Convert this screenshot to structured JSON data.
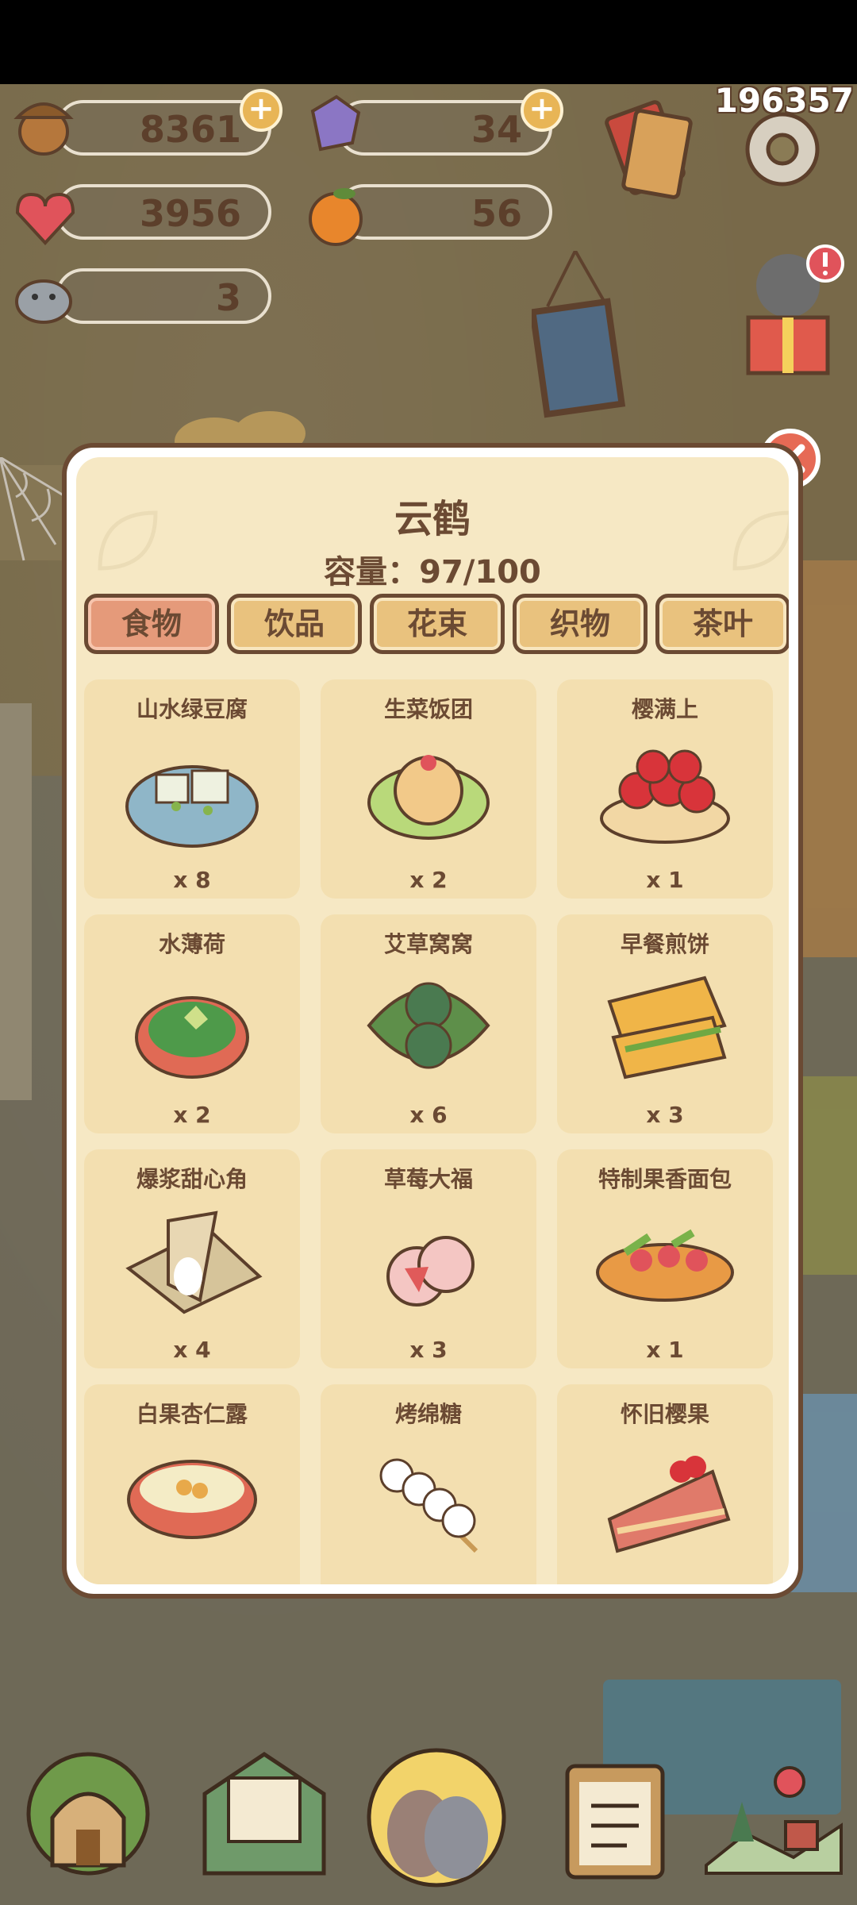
{
  "hud": {
    "score": "196357",
    "acorns": "8361",
    "gems": "34",
    "hearts": "3956",
    "oranges": "56",
    "bird_count": "3"
  },
  "panel": {
    "title": "云鹤",
    "capacity": "容量：97/100",
    "tabs": [
      "食物",
      "饮品",
      "花束",
      "织物",
      "茶叶"
    ],
    "active_tab": "食物",
    "items": [
      {
        "name": "山水绿豆腐",
        "count": "x 8"
      },
      {
        "name": "生菜饭团",
        "count": "x 2"
      },
      {
        "name": "樱满上",
        "count": "x 1"
      },
      {
        "name": "水薄荷",
        "count": "x 2"
      },
      {
        "name": "艾草窝窝",
        "count": "x 6"
      },
      {
        "name": "早餐煎饼",
        "count": "x 3"
      },
      {
        "name": "爆浆甜心角",
        "count": "x 4"
      },
      {
        "name": "草莓大福",
        "count": "x 3"
      },
      {
        "name": "特制果香面包",
        "count": "x 1"
      },
      {
        "name": "白果杏仁露",
        "count": ""
      },
      {
        "name": "烤绵糖",
        "count": ""
      },
      {
        "name": "怀旧樱果",
        "count": ""
      }
    ]
  },
  "colors": {
    "panel_border": "#6b4a33",
    "tab_active": "#e59a7a",
    "tab": "#e9c27e",
    "card": "#f3dfb0",
    "close": "#e66a55"
  }
}
